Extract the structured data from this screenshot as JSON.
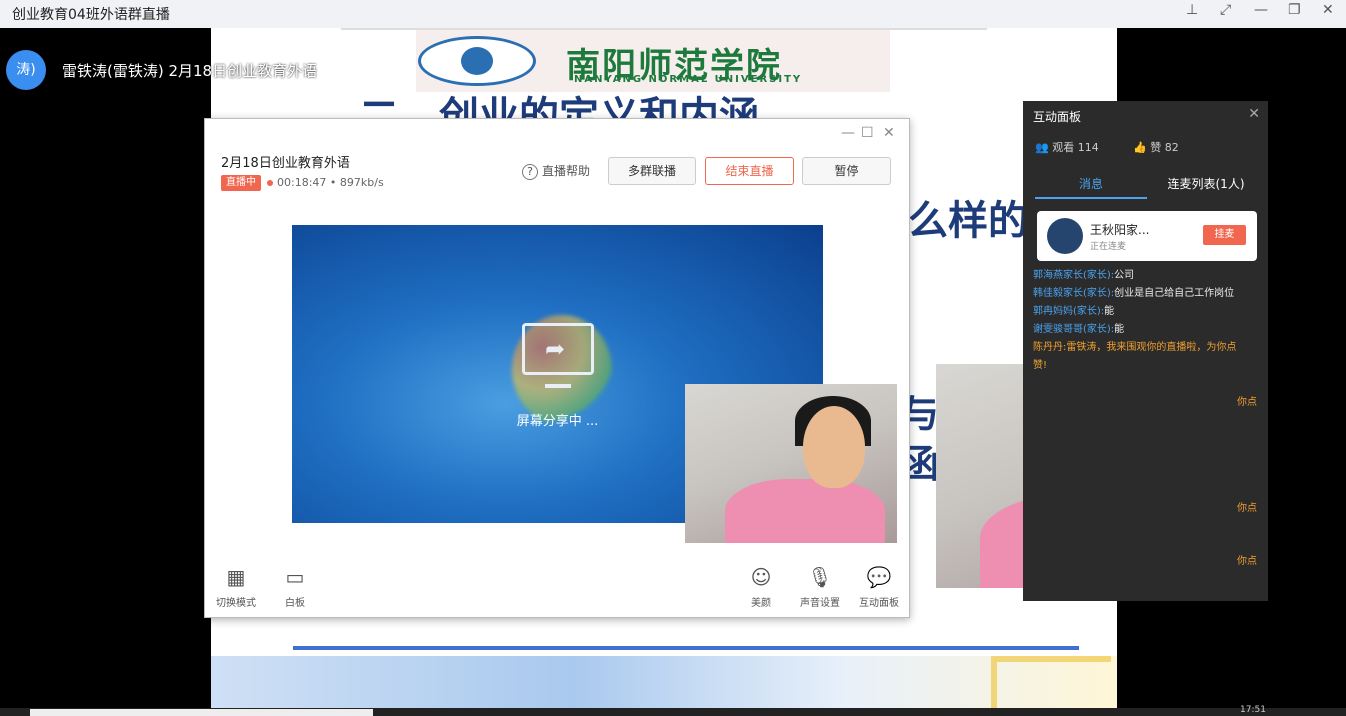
{
  "window": {
    "title": "创业教育04班外语群直播",
    "controls": [
      "pin-icon",
      "expand-icon",
      "minimize-icon",
      "restore-icon",
      "close-icon"
    ]
  },
  "slide": {
    "logo_cn": "南阳师范学院",
    "logo_en": "NANYANG NORMAL UNIVERSITY",
    "heading": "二、创业的定义和内涵",
    "frag1": "么样的",
    "frag2": "与",
    "frag3": "函"
  },
  "presenter": {
    "avatar": "涛)",
    "title": "雷铁涛(雷铁涛) 2月18日创业教育外语"
  },
  "broadcast": {
    "session": "2月18日创业教育外语",
    "status": "直播中",
    "meta": "00:18:47 • 897kb/s",
    "help": "直播帮助",
    "buttons": {
      "multi": "多群联播",
      "end": "结束直播",
      "pause": "暂停"
    },
    "sharing": "屏幕分享中 ...",
    "tools": {
      "switch": "切换模式",
      "board": "白板",
      "beauty": "美颜",
      "sound": "声音设置",
      "panel": "互动面板"
    }
  },
  "panel": {
    "title": "互动面板",
    "viewers": "观看 114",
    "likes": "赞 82",
    "tabs": [
      "消息",
      "连麦列表(1人)"
    ],
    "mic": {
      "name": "王秋阳家...",
      "status": "正在连麦",
      "hangup": "挂麦"
    },
    "messages": [
      {
        "user": "郭海燕家长(家长):",
        "text": "公司",
        "hl": false
      },
      {
        "user": "韩佳毅家长(家长):",
        "text": "创业是自己给自己工作岗位",
        "hl": false
      },
      {
        "user": "郭冉妈妈(家长):",
        "text": "能",
        "hl": false
      },
      {
        "user": "谢雯骏哥哥(家长):",
        "text": "能",
        "hl": false
      },
      {
        "user": "陈丹丹:",
        "text": "雷铁涛，我来围观你的直播啦，为你点",
        "hl": true
      },
      {
        "user": "",
        "text": "赞!",
        "hl": true
      }
    ],
    "truncated": [
      "你点",
      "你点",
      "你点"
    ]
  },
  "taskbar": {
    "clock": "17:51"
  }
}
